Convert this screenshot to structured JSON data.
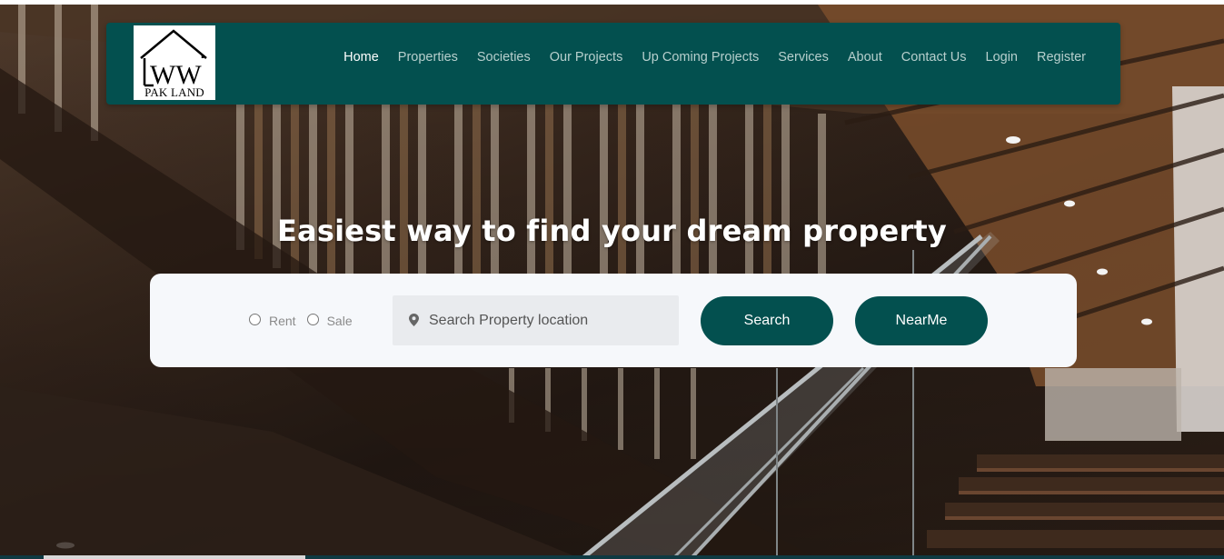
{
  "brand": {
    "logo_text": "WW",
    "logo_subtext": "PAK LAND"
  },
  "nav": {
    "items": [
      {
        "label": "Home",
        "active": true
      },
      {
        "label": "Properties",
        "active": false
      },
      {
        "label": "Societies",
        "active": false
      },
      {
        "label": "Our Projects",
        "active": false
      },
      {
        "label": "Up Coming Projects",
        "active": false
      },
      {
        "label": "Services",
        "active": false
      },
      {
        "label": "About",
        "active": false
      },
      {
        "label": "Contact Us",
        "active": false
      },
      {
        "label": "Login",
        "active": false
      },
      {
        "label": "Register",
        "active": false
      }
    ]
  },
  "hero": {
    "headline": "Easiest way to find your dream property"
  },
  "search": {
    "rent_label": "Rent",
    "sale_label": "Sale",
    "location_placeholder": "Search Property location",
    "location_icon": "map-pin-icon",
    "search_button": "Search",
    "nearme_button": "NearMe"
  },
  "colors": {
    "brand_green": "#03504f",
    "nav_text": "#b7cfcd",
    "nav_active": "#ffffff",
    "panel_bg": "#f6f8fb",
    "input_bg": "#e9ebee"
  }
}
